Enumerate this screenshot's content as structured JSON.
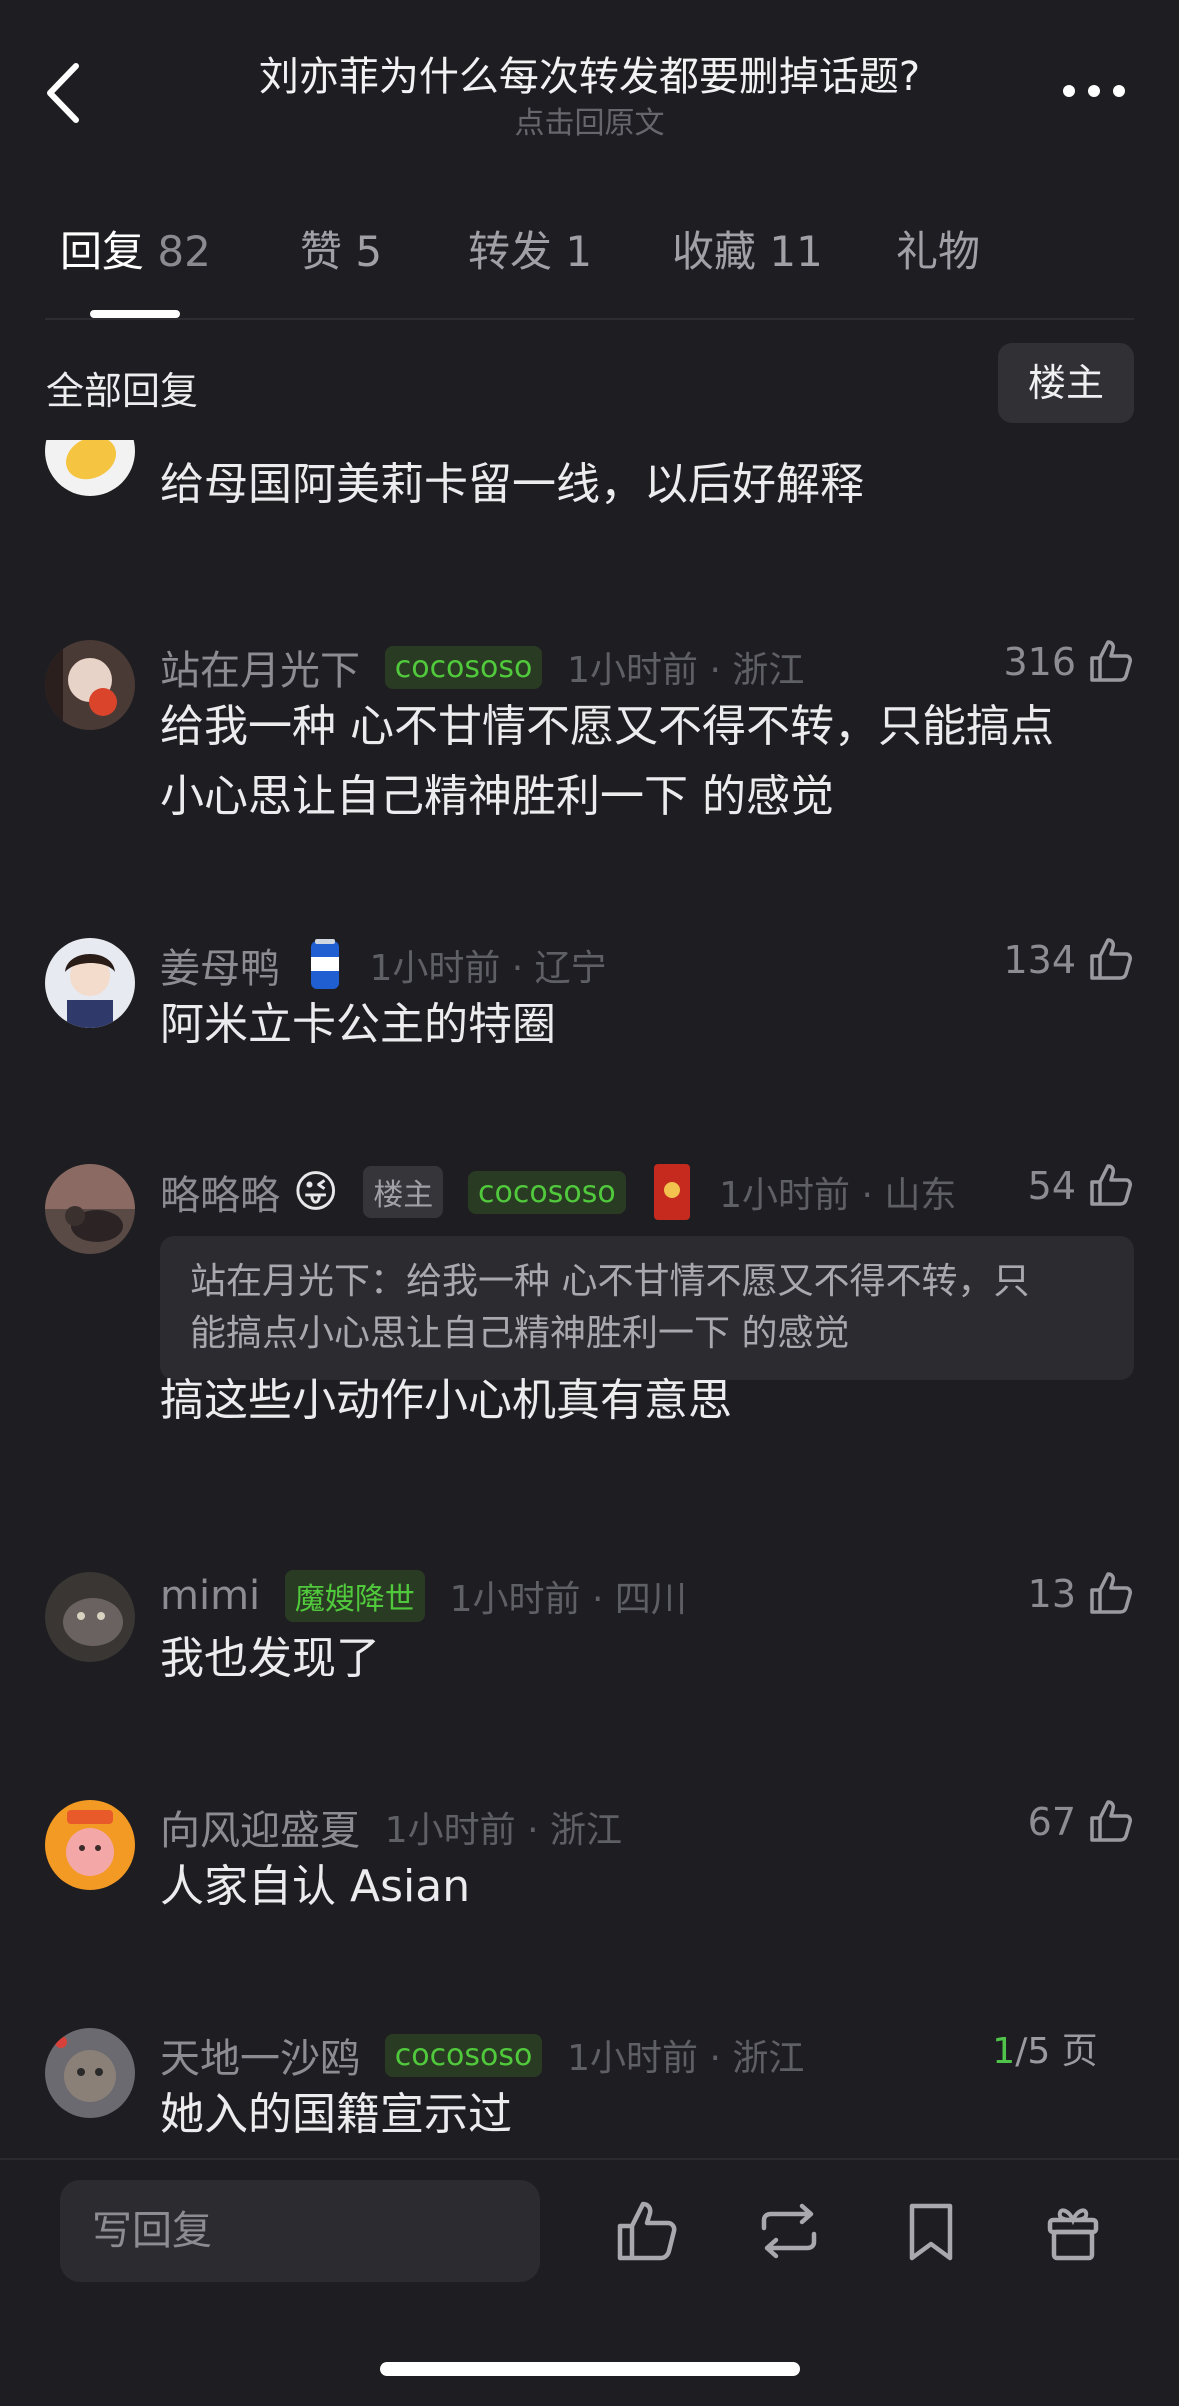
{
  "header": {
    "title": "刘亦菲为什么每次转发都要删掉话题?",
    "subtitle": "点击回原文"
  },
  "tabs": [
    {
      "label": "回复",
      "count": "82"
    },
    {
      "label": "赞",
      "count": "5"
    },
    {
      "label": "转发",
      "count": "1"
    },
    {
      "label": "收藏",
      "count": "11"
    },
    {
      "label": "礼物",
      "count": ""
    }
  ],
  "filter": {
    "label": "全部回复",
    "op_button": "楼主"
  },
  "comments": [
    {
      "user": "",
      "time": "",
      "likes": "",
      "text": "给母国阿美莉卡留一线，以后好解释"
    },
    {
      "user": "站在月光下",
      "badge": "cocososo",
      "time": "1小时前 · 浙江",
      "likes": "316",
      "text": "给我一种 心不甘情不愿又不得不转，只能搞点",
      "text2": "小心思让自己精神胜利一下 的感觉"
    },
    {
      "user": "姜母鸭",
      "time": "1小时前 · 辽宁",
      "likes": "134",
      "text": "阿米立卡公主的特圈"
    },
    {
      "user": "略略略",
      "emoji": "😜",
      "op_badge": "楼主",
      "badge": "cocososo",
      "time": "1小时前 · 山东",
      "likes": "54",
      "quote_line1": "站在月光下：给我一种 心不甘情不愿又不得不转，只",
      "quote_line2": "能搞点小心思让自己精神胜利一下 的感觉",
      "text": "搞这些小动作小心机真有意思"
    },
    {
      "user": "mimi",
      "badge": "魔嫂降世",
      "time": "1小时前 · 四川",
      "likes": "13",
      "text": "我也发现了"
    },
    {
      "user": "向风迎盛夏",
      "time": "1小时前 · 浙江",
      "likes": "67",
      "text": "人家自认 Asian"
    },
    {
      "user": "天地一沙鸥",
      "badge": "cocososo",
      "time": "1小时前 · 浙江",
      "likes": "",
      "text": "她入的国籍宣示过"
    }
  ],
  "pagination": {
    "current": "1",
    "rest": "/5 页"
  },
  "bottom": {
    "reply_placeholder": "写回复"
  }
}
